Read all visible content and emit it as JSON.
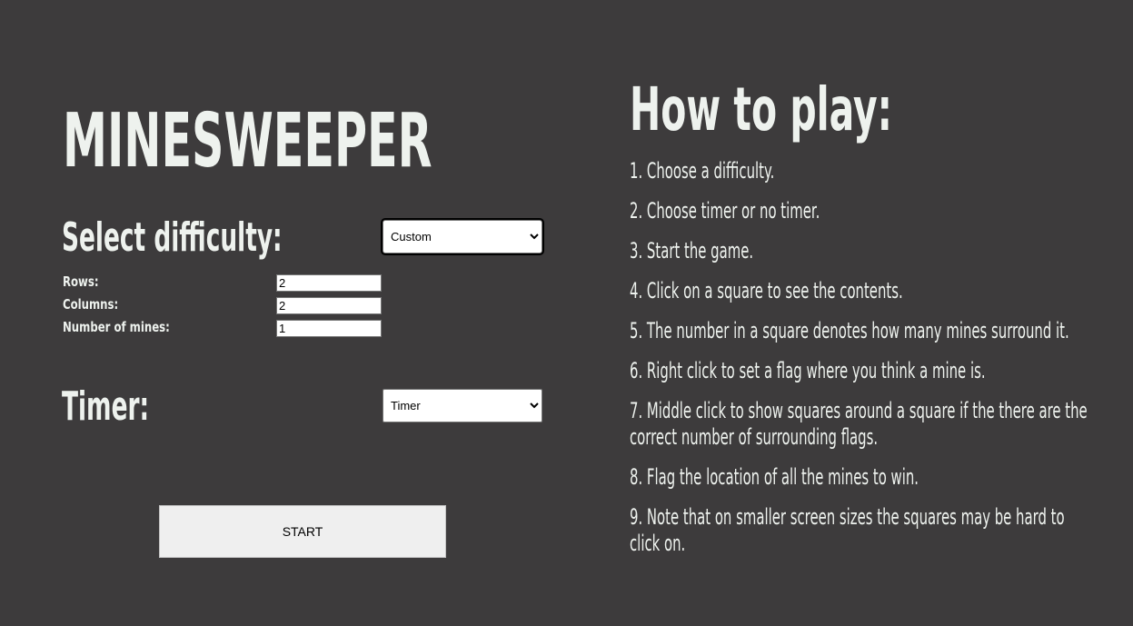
{
  "game": {
    "title": "MINESWEEPER"
  },
  "settings": {
    "difficulty_label": "Select difficulty:",
    "difficulty_selected": "Custom",
    "rows_label": "Rows:",
    "rows_value": "2",
    "columns_label": "Columns:",
    "columns_value": "2",
    "mines_label": "Number of mines:",
    "mines_value": "1",
    "timer_label": "Timer:",
    "timer_selected": "Timer",
    "start_label": "START"
  },
  "instructions": {
    "title": "How to play:",
    "steps": [
      "1. Choose a difficulty.",
      "2. Choose timer or no timer.",
      "3. Start the game.",
      "4. Click on a square to see the contents.",
      "5. The number in a square denotes how many mines surround it.",
      "6. Right click to set a flag where you think a mine is.",
      "7. Middle click to show squares around a square if the there are the correct number of surrounding flags.",
      "8. Flag the location of all the mines to win.",
      "9. Note that on smaller screen sizes the squares may be hard to click on."
    ]
  }
}
